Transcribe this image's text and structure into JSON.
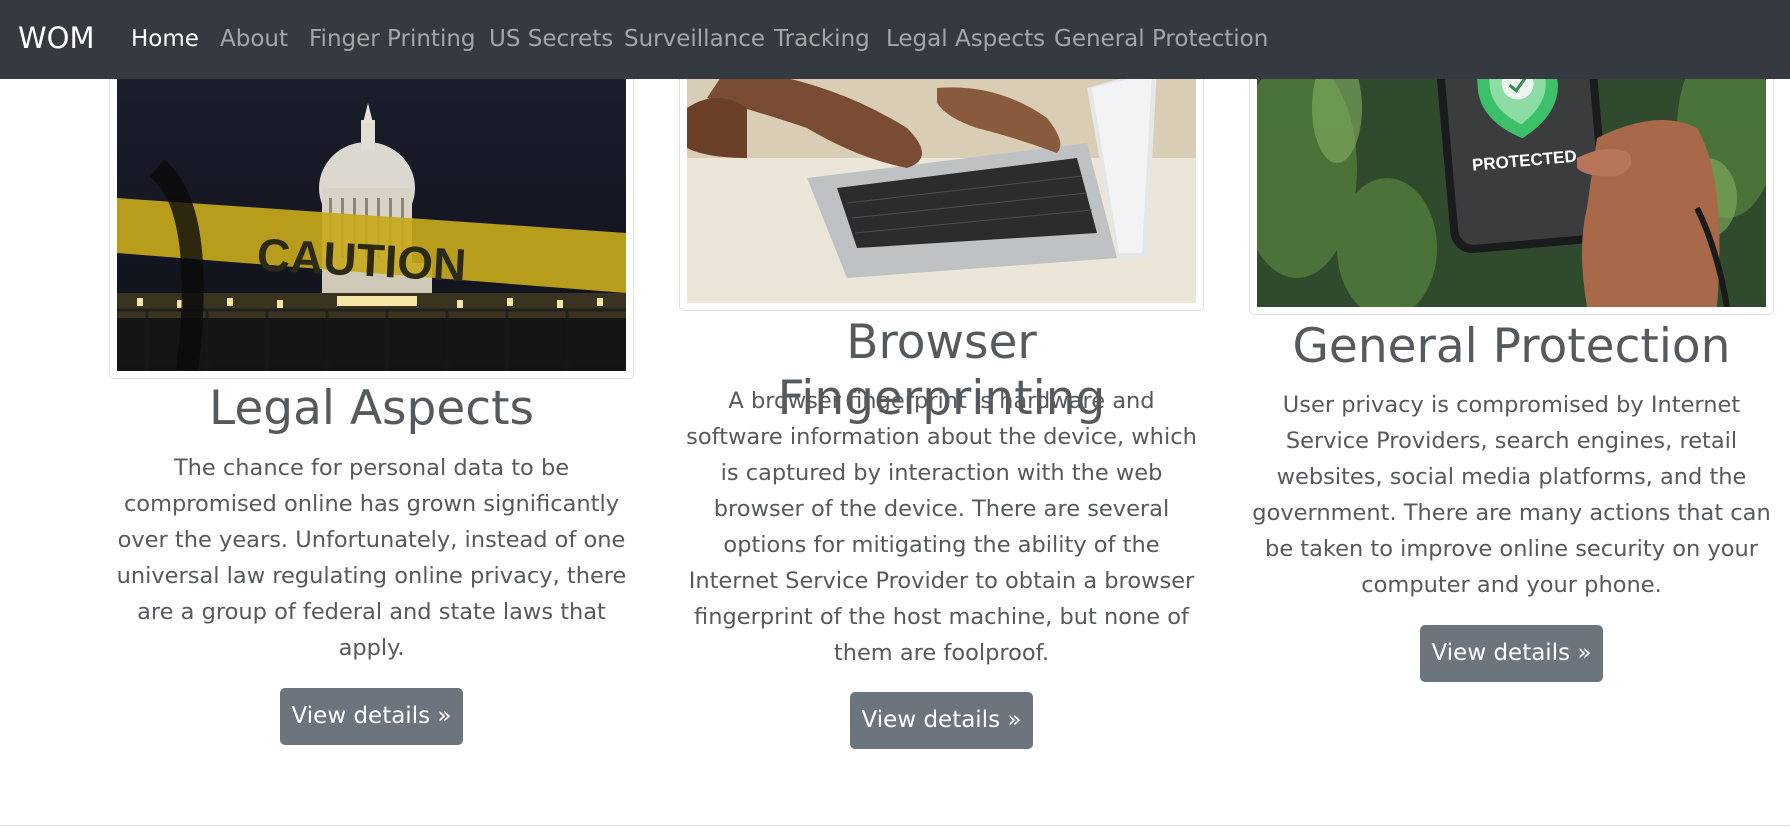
{
  "navbar": {
    "brand": "WOM",
    "items": [
      {
        "label": "Home",
        "active": true
      },
      {
        "label": "About"
      },
      {
        "label": "Finger Printing"
      },
      {
        "label": "US Secrets"
      },
      {
        "label": "Surveillance"
      },
      {
        "label": "Tracking"
      },
      {
        "label": "Legal Aspects"
      },
      {
        "label": "General Protection"
      }
    ]
  },
  "cards": [
    {
      "title": "Legal Aspects",
      "text_lines": [
        "The chance for personal data to be",
        "compromised online has grown significantly",
        "over the years. Unfortunately, instead of one",
        "universal law regulating online privacy, there",
        "are a group of federal and state laws that",
        "apply."
      ],
      "button": "View details »",
      "image_text": "CAUTION"
    },
    {
      "title": "Browser Fingerprinting",
      "text_lines": [
        "A browser fingerprint is hardware and",
        "software information about the device, which",
        "is captured by interaction with the web",
        "browser of the device. There are several",
        "options for mitigating the ability of the",
        "Internet Service Provider to obtain a browser",
        "fingerprint of the host machine, but none of",
        "them are foolproof."
      ],
      "button": "View details »"
    },
    {
      "title": "General Protection",
      "text_lines": [
        "User privacy is compromised by Internet",
        "Service Providers, search engines, retail",
        "websites, social media platforms, and the",
        "government. There are many actions that can",
        "be taken to improve online security on your",
        "computer and your phone."
      ],
      "button": "View details »",
      "image_text": "PROTECTED"
    }
  ],
  "colors": {
    "navbar_bg": "#343a40",
    "button_bg": "#6c757d",
    "text": "#555a5f"
  }
}
